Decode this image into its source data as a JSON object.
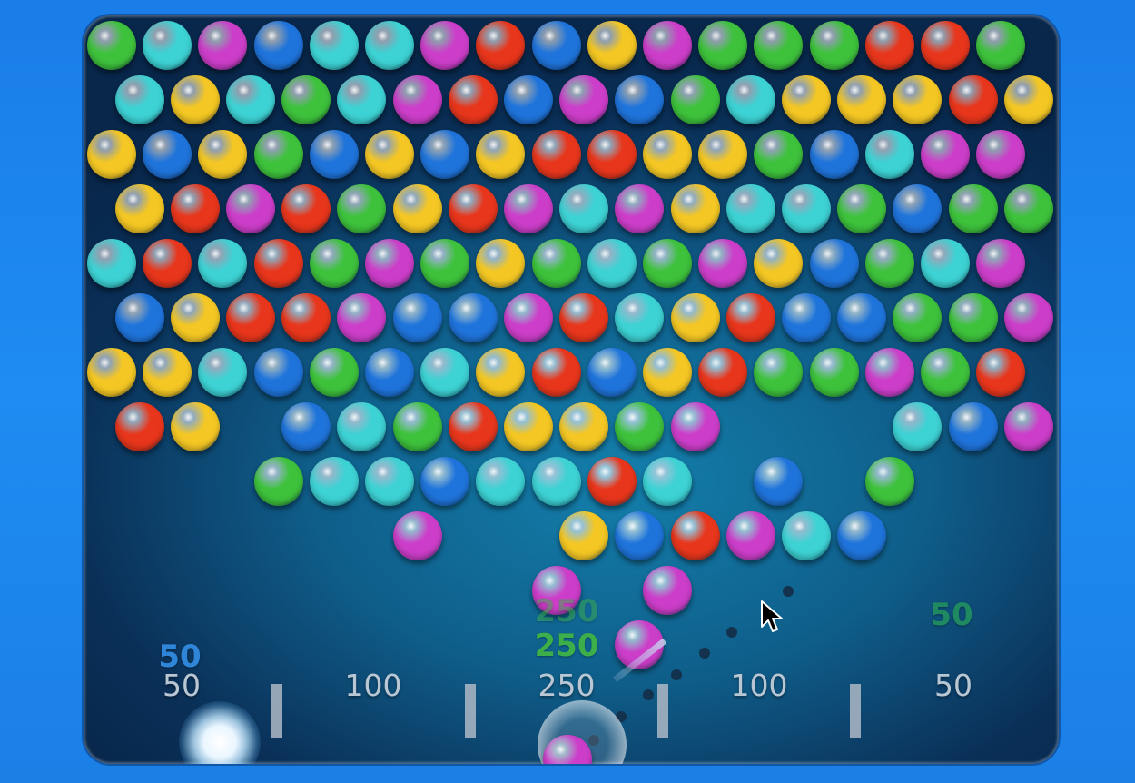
{
  "colors": {
    "green": "#3ec23c",
    "cyan": "#3dd2d4",
    "purple": "#cc3ec9",
    "blue": "#1f74db",
    "red": "#e8361c",
    "yellow": "#f4c724"
  },
  "bubble_rows": [
    [
      "green",
      "cyan",
      "purple",
      "blue",
      "cyan",
      "cyan",
      "purple",
      "red",
      "blue",
      "yellow",
      "purple",
      "green",
      "green",
      "green",
      "red",
      "red",
      "green"
    ],
    [
      "cyan",
      "yellow",
      "cyan",
      "green",
      "cyan",
      "purple",
      "red",
      "blue",
      "purple",
      "blue",
      "green",
      "cyan",
      "yellow",
      "yellow",
      "yellow",
      "red",
      "yellow"
    ],
    [
      "yellow",
      "blue",
      "yellow",
      "green",
      "blue",
      "yellow",
      "blue",
      "yellow",
      "red",
      "red",
      "yellow",
      "yellow",
      "green",
      "blue",
      "cyan",
      "purple",
      "purple"
    ],
    [
      "yellow",
      "red",
      "purple",
      "red",
      "green",
      "yellow",
      "red",
      "purple",
      "cyan",
      "purple",
      "yellow",
      "cyan",
      "cyan",
      "green",
      "blue",
      "green",
      "green"
    ],
    [
      "cyan",
      "red",
      "cyan",
      "red",
      "green",
      "purple",
      "green",
      "yellow",
      "green",
      "cyan",
      "green",
      "purple",
      "yellow",
      "blue",
      "green",
      "cyan",
      "purple"
    ],
    [
      "blue",
      "yellow",
      "red",
      "red",
      "purple",
      "blue",
      "blue",
      "purple",
      "red",
      "cyan",
      "yellow",
      "red",
      "blue",
      "blue",
      "green",
      "green",
      "purple"
    ],
    [
      "yellow",
      "yellow",
      "cyan",
      "blue",
      "green",
      "blue",
      "cyan",
      "yellow",
      "red",
      "blue",
      "yellow",
      "red",
      "green",
      "green",
      "purple",
      "green",
      "red"
    ],
    [
      "red",
      "yellow",
      null,
      "blue",
      "cyan",
      "green",
      "red",
      "yellow",
      "yellow",
      "green",
      "purple",
      null,
      null,
      null,
      "cyan",
      "blue",
      "purple"
    ],
    [
      null,
      null,
      null,
      "green",
      "cyan",
      "cyan",
      "blue",
      "cyan",
      "cyan",
      "red",
      "cyan",
      null,
      "blue",
      null,
      "green",
      null,
      null
    ],
    [
      null,
      null,
      null,
      null,
      null,
      "purple",
      null,
      null,
      "yellow",
      "blue",
      "red",
      "purple",
      "cyan",
      "blue",
      null,
      null,
      null
    ],
    [
      null,
      null,
      null,
      null,
      null,
      null,
      null,
      null,
      "purple",
      null,
      "purple",
      null,
      null,
      null,
      null,
      null,
      null
    ],
    [
      null,
      null,
      null,
      null,
      null,
      null,
      null,
      null,
      null,
      "purple",
      null,
      null,
      null,
      null,
      null,
      null,
      null
    ]
  ],
  "current_bubble": "purple",
  "scoring_zones": [
    {
      "label": "50"
    },
    {
      "label": "100"
    },
    {
      "label": "250"
    },
    {
      "label": "100"
    },
    {
      "label": "50"
    }
  ],
  "floating_scores": [
    {
      "text": "50",
      "color": "#2f86d8"
    },
    {
      "text": "250",
      "color": "#3cae4a"
    },
    {
      "text": "250",
      "color": "#3cae4a"
    },
    {
      "text": "50",
      "color": "#1f8a62"
    }
  ]
}
